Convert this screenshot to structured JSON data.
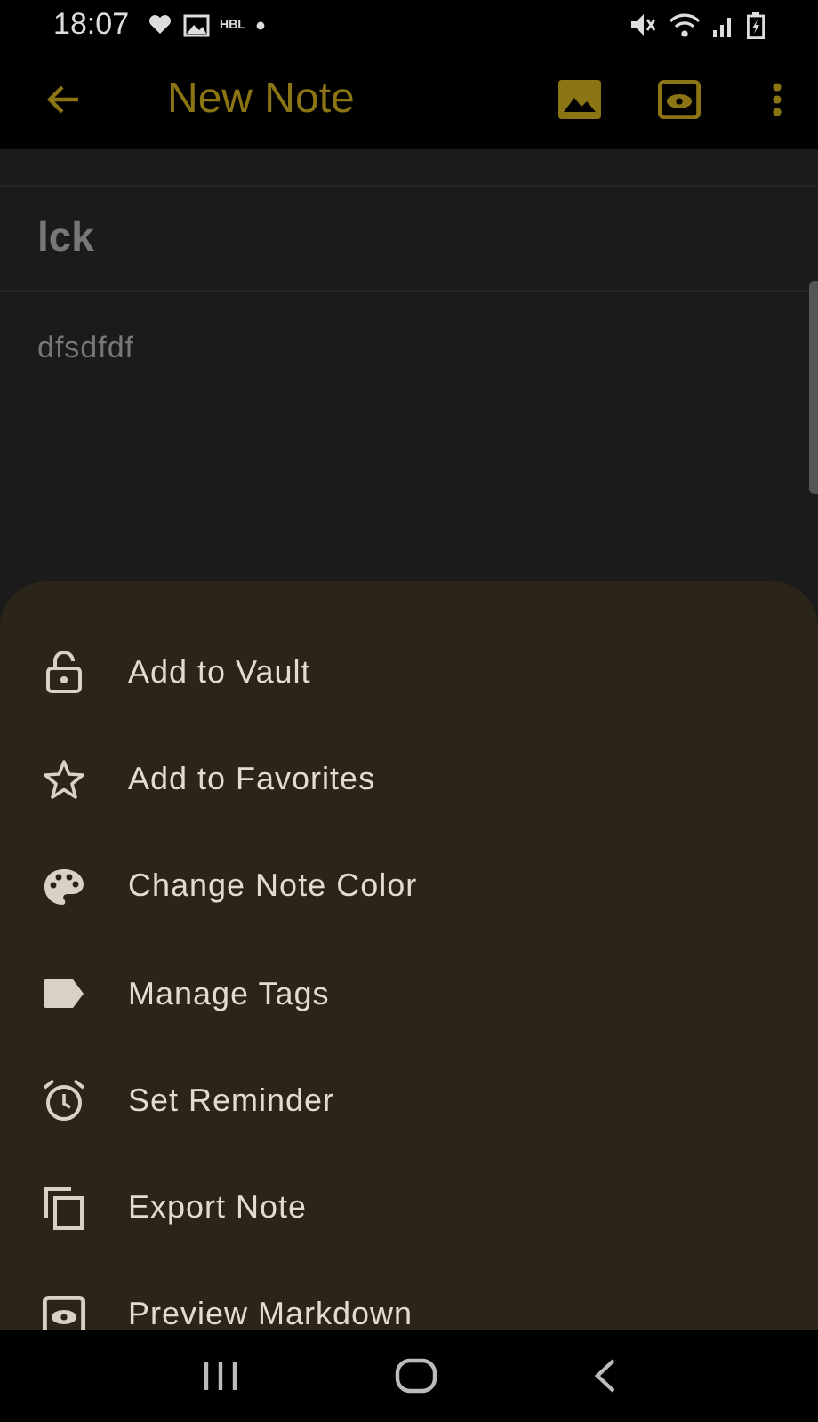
{
  "status_bar": {
    "time": "18:07",
    "carrier": "HBL"
  },
  "app_bar": {
    "title": "New Note"
  },
  "note": {
    "title": "lck",
    "body": "dfsdfdf"
  },
  "sheet": {
    "items": [
      {
        "label": "Add to Vault"
      },
      {
        "label": "Add to Favorites"
      },
      {
        "label": "Change Note Color"
      },
      {
        "label": "Manage Tags"
      },
      {
        "label": "Set Reminder"
      },
      {
        "label": "Export Note"
      },
      {
        "label": "Preview Markdown"
      }
    ]
  }
}
